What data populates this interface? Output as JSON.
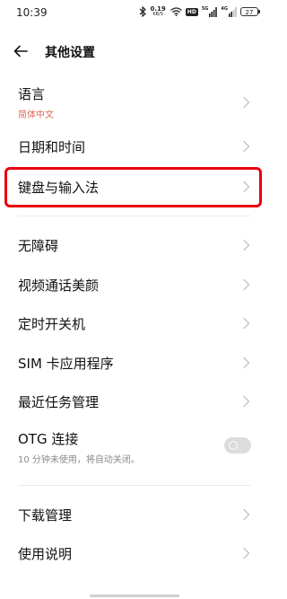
{
  "status_bar": {
    "time": "10:39",
    "net_speed_value": "0.19",
    "net_speed_unit": "KB/S",
    "hd_label": "HD",
    "signal1_tag": "5G",
    "signal2_tag": "4G",
    "battery": "27"
  },
  "header": {
    "title": "其他设置"
  },
  "items": [
    {
      "title": "语言",
      "subtitle": "简体中文",
      "subtitle_color": "#e06a55"
    },
    {
      "title": "日期和时间"
    },
    {
      "title": "键盘与输入法",
      "highlight_color": "#e8000c"
    },
    {
      "title": "无障碍"
    },
    {
      "title": "视频通话美颜"
    },
    {
      "title": "定时开关机"
    },
    {
      "title": "SIM 卡应用程序"
    },
    {
      "title": "最近任务管理"
    },
    {
      "title": "OTG 连接",
      "subtitle": "10 分钟未使用，将自动关闭。",
      "subtitle_color": "#8a8a8a",
      "toggle_on": false
    },
    {
      "title": "下载管理"
    },
    {
      "title": "使用说明"
    }
  ]
}
